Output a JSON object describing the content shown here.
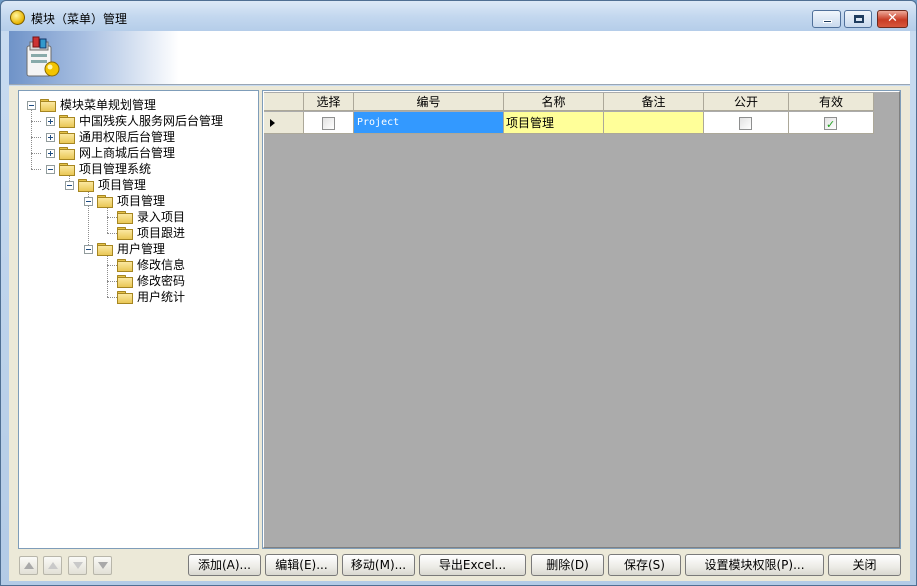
{
  "window": {
    "title": "模块（菜单）管理"
  },
  "tree": {
    "root": "模块菜单规划管理",
    "items": [
      {
        "label": "中国残疾人服务网后台管理"
      },
      {
        "label": "通用权限后台管理"
      },
      {
        "label": "网上商城后台管理"
      },
      {
        "label": "项目管理系统"
      },
      {
        "label": "项目管理"
      },
      {
        "label": "项目管理"
      },
      {
        "label": "录入项目"
      },
      {
        "label": "项目跟进"
      },
      {
        "label": "用户管理"
      },
      {
        "label": "修改信息"
      },
      {
        "label": "修改密码"
      },
      {
        "label": "用户统计"
      }
    ]
  },
  "grid": {
    "columns": [
      "选择",
      "编号",
      "名称",
      "备注",
      "公开",
      "有效"
    ],
    "rows": [
      {
        "selected": false,
        "code": "Project",
        "name": "项目管理",
        "note": "",
        "public": false,
        "valid": true
      }
    ]
  },
  "buttons": {
    "add": "添加(A)...",
    "edit": "编辑(E)...",
    "move": "移动(M)...",
    "export": "导出Excel...",
    "delete": "删除(D)",
    "save": "保存(S)",
    "permissions": "设置模块权限(P)...",
    "close": "关闭"
  },
  "colors": {
    "selected_cell": "#3399ff",
    "edit_cell": "#ffff99",
    "accent": "#6f93c8"
  }
}
